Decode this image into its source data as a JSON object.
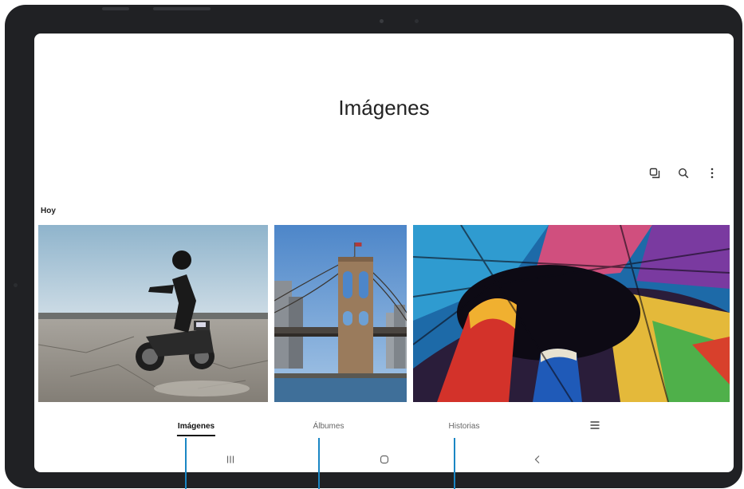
{
  "header": {
    "title": "Imágenes"
  },
  "toolbar": {
    "icons": [
      "select-mode-icon",
      "search-icon",
      "more-options-icon"
    ]
  },
  "gallery": {
    "section_label": "Hoy",
    "photos": [
      {
        "name": "motorcycle-photo"
      },
      {
        "name": "bridge-photo"
      },
      {
        "name": "stained-glass-photo"
      }
    ]
  },
  "tabs": [
    {
      "label": "Imágenes",
      "active": true
    },
    {
      "label": "Álbumes",
      "active": false
    },
    {
      "label": "Historias",
      "active": false
    }
  ],
  "nav": {
    "icons": [
      "recent-apps-icon",
      "home-icon",
      "back-icon"
    ]
  },
  "colors": {
    "callout": "#1a86c4",
    "bezel": "#202124",
    "active_tab": "#111111"
  }
}
